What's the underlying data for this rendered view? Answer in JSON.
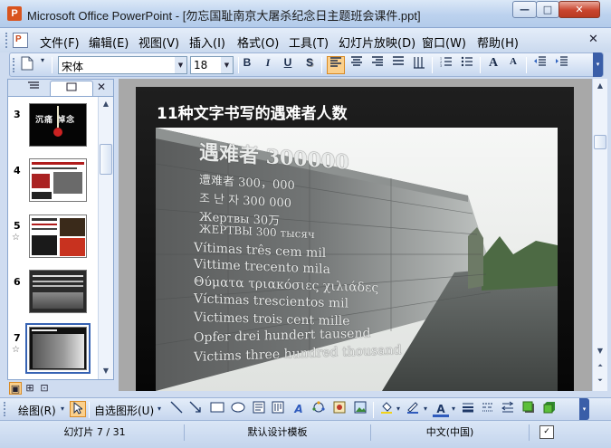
{
  "window": {
    "title": "Microsoft Office PowerPoint - [勿忘国耻南京大屠杀纪念日主题班会课件.ppt]",
    "controls": {
      "minimize": "—",
      "maximize": "□",
      "close": "✕"
    }
  },
  "menu": {
    "items": [
      {
        "label": "文件(F)"
      },
      {
        "label": "编辑(E)"
      },
      {
        "label": "视图(V)"
      },
      {
        "label": "插入(I)"
      },
      {
        "label": "格式(O)"
      },
      {
        "label": "工具(T)"
      },
      {
        "label": "幻灯片放映(D)"
      },
      {
        "label": "窗口(W)"
      },
      {
        "label": "帮助(H)"
      }
    ],
    "close_glyph": "✕"
  },
  "toolbar": {
    "font_name": "宋体",
    "font_size": "18",
    "bold": "B",
    "italic": "I",
    "underline": "U",
    "shadow": "S",
    "grow_font": "A",
    "shrink_font": "A",
    "active_alignment": "left",
    "icons": [
      "new-document-icon",
      "bold-icon",
      "italic-icon",
      "underline-icon",
      "shadow-icon",
      "align-left-icon",
      "align-center-icon",
      "align-right-icon",
      "distribute-icon",
      "numbering-icon",
      "bullets-icon",
      "grow-font-icon",
      "shrink-font-icon",
      "decrease-indent-icon",
      "increase-indent-icon"
    ]
  },
  "outline_pane": {
    "close_glyph": "✕",
    "tabs": [
      "outline-tab",
      "slides-tab"
    ],
    "slides": [
      {
        "number": "3",
        "star": "",
        "caption": "沉痛 悼念"
      },
      {
        "number": "4",
        "star": ""
      },
      {
        "number": "5",
        "star": "☆"
      },
      {
        "number": "6",
        "star": ""
      },
      {
        "number": "7",
        "star": "☆"
      }
    ],
    "selected_slide": "7"
  },
  "slide": {
    "title": "11种文字书写的遇难者人数",
    "wall_lines": [
      "遇难者 300000",
      "遭难者    300，000",
      "조 난 자    300 000",
      "Жертвы    30万",
      "ЖЕРТВЫ    300 тысяч",
      "Vítimas    três cem mil",
      "Vittime    trecento mila",
      "Θύματα    τριακόσιες χιλιάδες",
      "Víctimas    trescientos mil",
      "Victimes    trois cent mille",
      "Opfer    drei hundert tausend",
      "Victims    three hundred thousand"
    ]
  },
  "draw_toolbar": {
    "draw_label": "绘图(R)",
    "autoshapes_label": "自选图形(U)"
  },
  "status": {
    "slide_position": "幻灯片 7 / 31",
    "design": "默认设计模板",
    "language": "中文(中国)"
  },
  "colors": {
    "accent": "#3662b3",
    "active_button": "#fbd08c",
    "close_button": "#c9452e"
  }
}
